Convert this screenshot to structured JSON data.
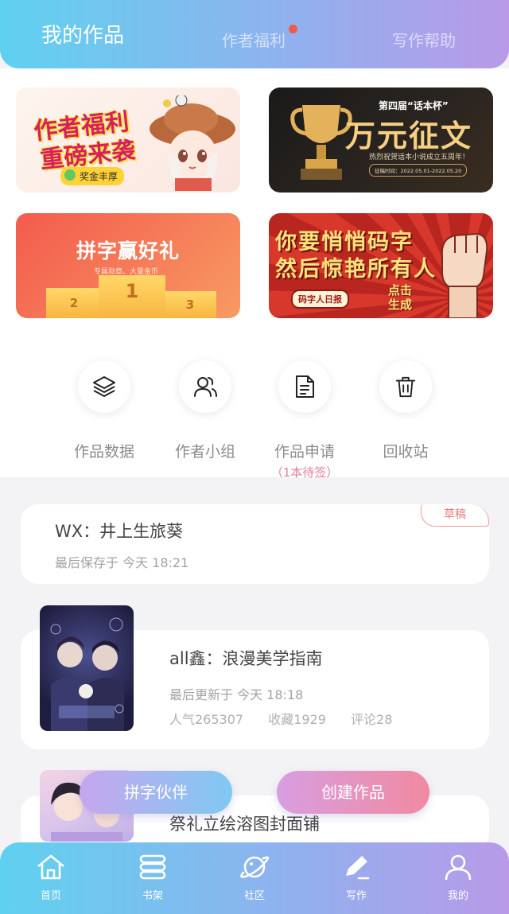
{
  "header": {
    "tabs": [
      {
        "label": "我的作品",
        "active": true
      },
      {
        "label": "作者福利",
        "active": false,
        "has_dot": true
      },
      {
        "label": "写作帮助",
        "active": false
      }
    ]
  },
  "banners": {
    "b1": {
      "line1": "作者福利",
      "line2": "重磅来袭",
      "badge": "奖金丰厚"
    },
    "b2": {
      "title_small": "第四届“话本杯”",
      "title_big": "万元征文",
      "subtitle": "热烈祝贺话本小说成立五周年！",
      "date": "征稿时间：2022.05.01-2022.05.20"
    },
    "b3": {
      "title": "拼字赢好礼",
      "subtitle": "专属勋章、大量金币",
      "podium": [
        "1",
        "2",
        "3"
      ]
    },
    "b4": {
      "line1": "你要悄悄码字",
      "line2": "然后惊艳所有人",
      "pill": "码字人日报",
      "cta1": "点击",
      "cta2": "生成"
    }
  },
  "actions": [
    {
      "label": "作品数据",
      "icon": "layers-icon"
    },
    {
      "label": "作者小组",
      "icon": "group-icon"
    },
    {
      "label": "作品申请",
      "sub": "（1本待签）",
      "icon": "document-icon"
    },
    {
      "label": "回收站",
      "icon": "trash-icon"
    }
  ],
  "works": [
    {
      "title": "WX：井上生旅葵",
      "meta": "最后保存于 今天 18:21",
      "tag": "草稿"
    },
    {
      "title": "all鑫：浪漫美学指南",
      "meta": "最后更新于 今天 18:18",
      "stats": [
        "人气265307",
        "收藏1929",
        "评论28"
      ]
    },
    {
      "title": "祭礼立绘溶图封面铺"
    }
  ],
  "floating_buttons": {
    "left": "拼字伙伴",
    "right": "创建作品"
  },
  "bottom_nav": [
    {
      "label": "首页",
      "icon": "home-icon"
    },
    {
      "label": "书架",
      "icon": "bookshelf-icon"
    },
    {
      "label": "社区",
      "icon": "planet-icon"
    },
    {
      "label": "写作",
      "icon": "pen-icon",
      "active": true
    },
    {
      "label": "我的",
      "icon": "user-icon"
    }
  ],
  "colors": {
    "accent_start": "#5fd1f0",
    "accent_end": "#b89ae8",
    "draft": "#ec7a7a",
    "pending": "#e0829a"
  }
}
